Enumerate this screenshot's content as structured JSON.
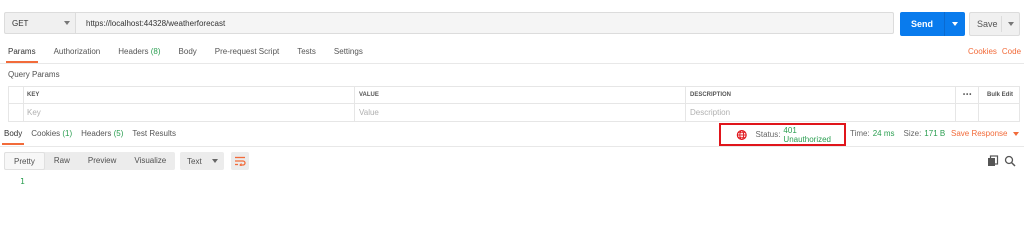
{
  "request": {
    "method": "GET",
    "url": "https://localhost:44328/weatherforecast",
    "send_label": "Send",
    "save_label": "Save"
  },
  "request_tabs": [
    {
      "label": "Params",
      "count": ""
    },
    {
      "label": "Authorization",
      "count": ""
    },
    {
      "label": "Headers",
      "count": "(8)"
    },
    {
      "label": "Body",
      "count": ""
    },
    {
      "label": "Pre-request Script",
      "count": ""
    },
    {
      "label": "Tests",
      "count": ""
    },
    {
      "label": "Settings",
      "count": ""
    }
  ],
  "request_links": {
    "cookies": "Cookies",
    "code": "Code"
  },
  "query_params": {
    "title": "Query Params",
    "headers": {
      "key": "KEY",
      "value": "VALUE",
      "description": "DESCRIPTION"
    },
    "placeholders": {
      "key": "Key",
      "value": "Value",
      "description": "Description"
    },
    "more": "•••",
    "bulk_edit": "Bulk Edit"
  },
  "response_tabs": [
    {
      "label": "Body",
      "count": ""
    },
    {
      "label": "Cookies",
      "count": "(1)"
    },
    {
      "label": "Headers",
      "count": "(5)"
    },
    {
      "label": "Test Results",
      "count": ""
    }
  ],
  "response_meta": {
    "status_label": "Status:",
    "status_value": "401 Unauthorized",
    "time_label": "Time:",
    "time_value": "24 ms",
    "size_label": "Size:",
    "size_value": "171 B",
    "save_response": "Save Response"
  },
  "response_view": {
    "modes": [
      "Pretty",
      "Raw",
      "Preview",
      "Visualize"
    ],
    "format": "Text",
    "line_number": "1"
  },
  "colors": {
    "accent": "#f26b3a",
    "send": "#097bed",
    "success": "#2a9e50",
    "highlight": "#e0151b"
  }
}
